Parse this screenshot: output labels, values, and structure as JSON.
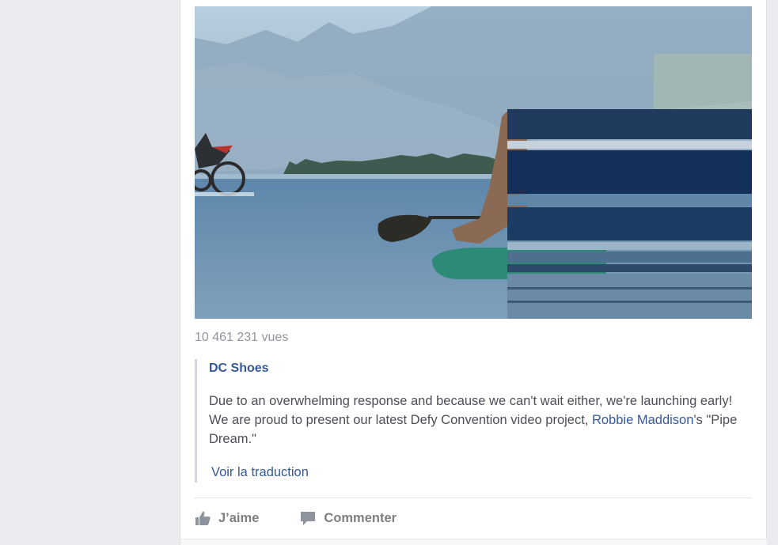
{
  "video": {
    "views": "10 461 231 vues"
  },
  "shared_post": {
    "author": "DC Shoes",
    "text_before_link": "Due to an overwhelming response and because we can't wait either, we're launching early! We are proud to present our latest Defy Convention video project, ",
    "link_text": "Robbie Maddison",
    "text_after_link": "'s \"Pipe Dream.\"",
    "translate_label": "Voir la traduction"
  },
  "actions": {
    "like_label": "J’aime",
    "comment_label": "Commenter"
  },
  "colors": {
    "link": "#365899",
    "page_background": "#e9ebee",
    "action_text": "#7f7f7f"
  }
}
